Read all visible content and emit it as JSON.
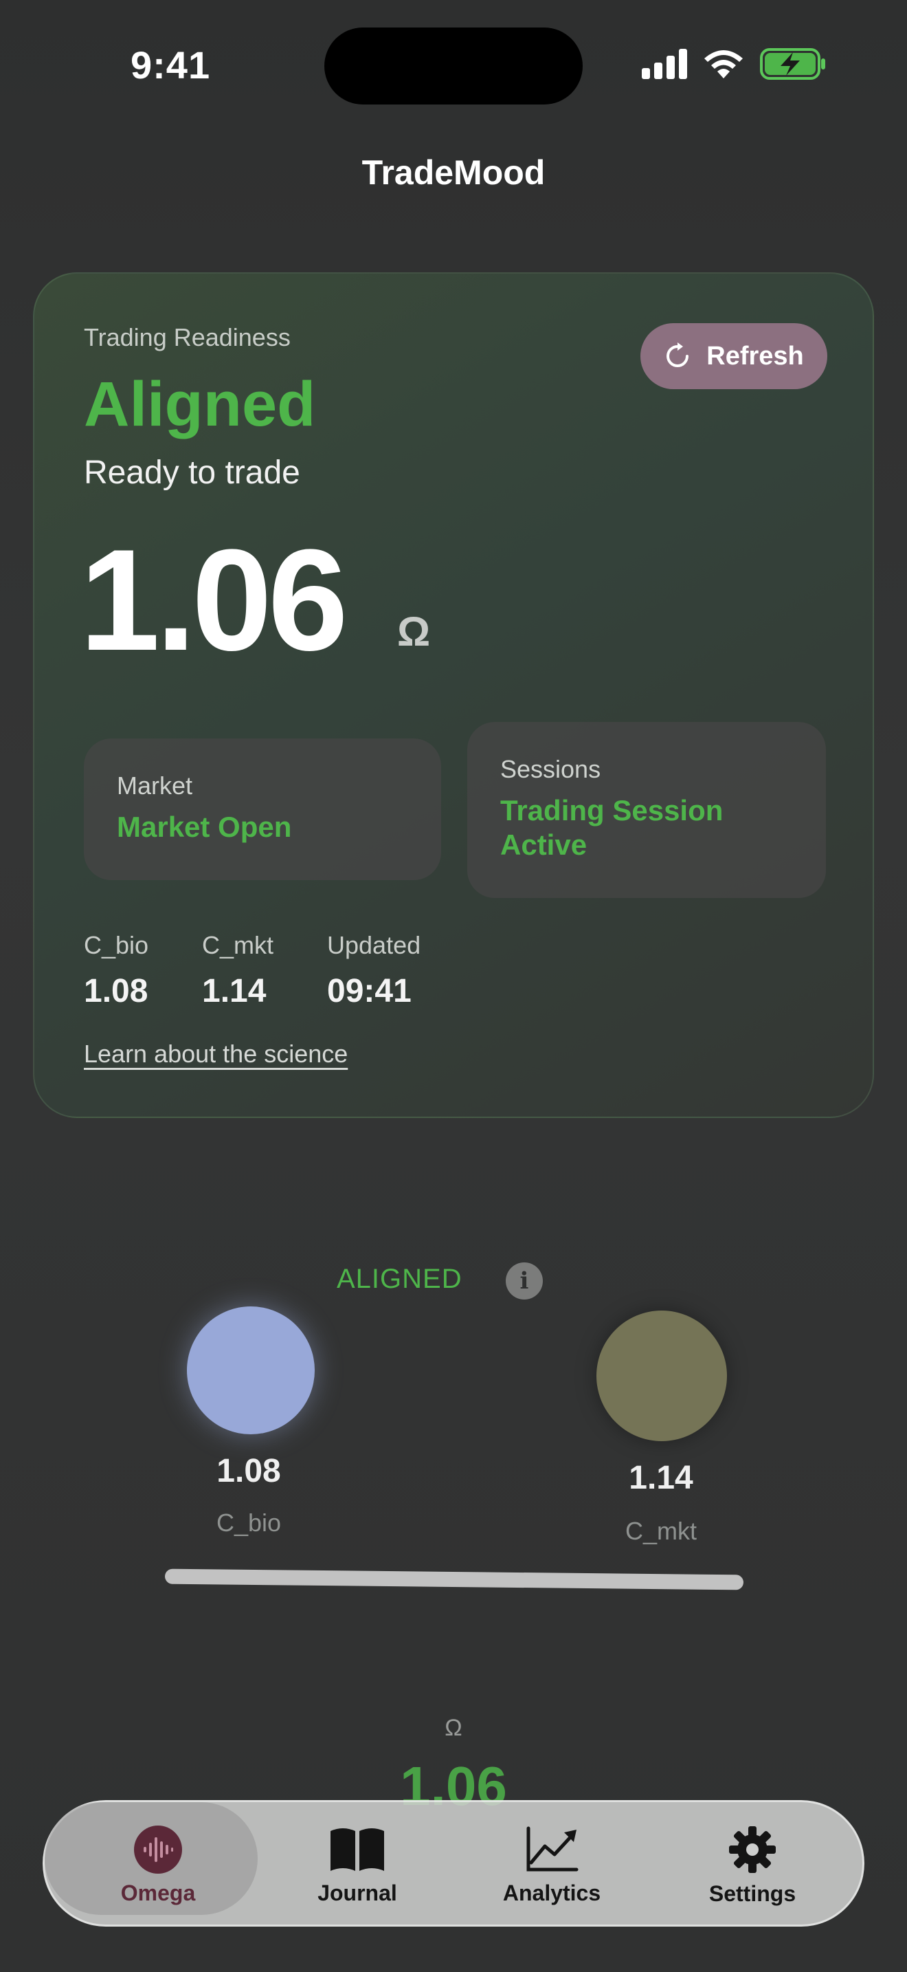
{
  "status_bar": {
    "time": "9:41"
  },
  "nav": {
    "title": "TradeMood"
  },
  "readiness": {
    "label": "Trading Readiness",
    "state": "Aligned",
    "subtitle": "Ready to trade",
    "refresh_label": "Refresh",
    "score": "1.06",
    "unit": "Ω",
    "market": {
      "label": "Market",
      "value": "Market Open"
    },
    "sessions": {
      "label": "Sessions",
      "value": "Trading Session Active"
    },
    "metrics": [
      {
        "label": "C_bio",
        "value": "1.08"
      },
      {
        "label": "C_mkt",
        "value": "1.14"
      },
      {
        "label": "Updated",
        "value": "09:41"
      }
    ],
    "science_link": "Learn about the science"
  },
  "visual": {
    "state_label": "ALIGNED",
    "info_glyph": "i",
    "bio": {
      "value": "1.08",
      "label": "C_bio"
    },
    "mkt": {
      "value": "1.14",
      "label": "C_mkt"
    },
    "omega_symbol": "Ω",
    "omega_value": "1.06"
  },
  "tabs": [
    {
      "label": "Omega",
      "icon": "waveform-icon",
      "active": true
    },
    {
      "label": "Journal",
      "icon": "book-icon",
      "active": false
    },
    {
      "label": "Analytics",
      "icon": "chart-line-icon",
      "active": false
    },
    {
      "label": "Settings",
      "icon": "gear-icon",
      "active": false
    }
  ],
  "colors": {
    "accent_green": "#4eb54a",
    "refresh_button": "#8c7080",
    "bio_orb": "#98a8d8",
    "mkt_orb": "#757456",
    "active_tab": "#5b2838"
  }
}
